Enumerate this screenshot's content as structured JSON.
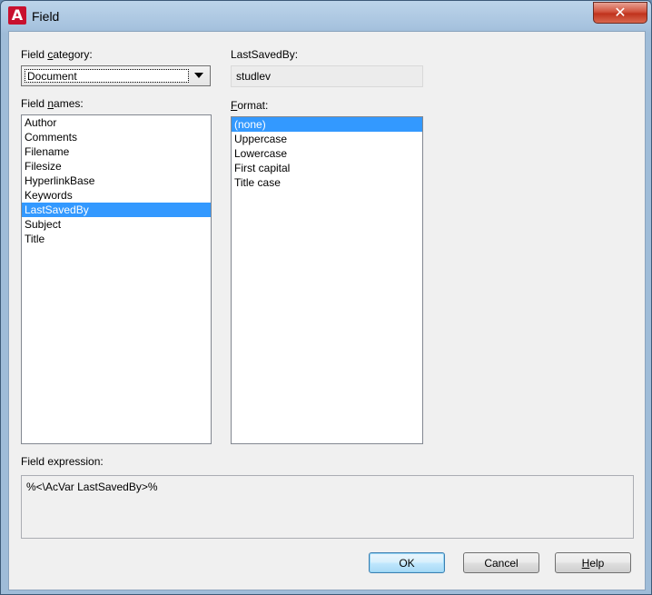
{
  "window": {
    "title": "Field",
    "app_icon": "A",
    "close_glyph": "✕"
  },
  "field_category": {
    "label_pre": "Field ",
    "label_u": "c",
    "label_post": "ategory:",
    "value": "Document"
  },
  "field_names": {
    "label_pre": "Field ",
    "label_u": "n",
    "label_post": "ames:",
    "items": [
      "Author",
      "Comments",
      "Filename",
      "Filesize",
      "HyperlinkBase",
      "Keywords",
      "LastSavedBy",
      "Subject",
      "Title"
    ],
    "selected": "LastSavedBy"
  },
  "value_box": {
    "label": "LastSavedBy:",
    "value": "studlev"
  },
  "format": {
    "label_u": "F",
    "label_post": "ormat:",
    "items": [
      "(none)",
      "Uppercase",
      "Lowercase",
      "First capital",
      "Title case"
    ],
    "selected": "(none)"
  },
  "expression": {
    "label": "Field expression:",
    "value": "%<\\AcVar LastSavedBy>%"
  },
  "buttons": {
    "ok": "OK",
    "cancel": "Cancel",
    "help_u": "H",
    "help_rest": "elp"
  },
  "colors": {
    "selection": "#3399ff",
    "close_button": "#c0331d",
    "app_icon": "#c8102e"
  }
}
